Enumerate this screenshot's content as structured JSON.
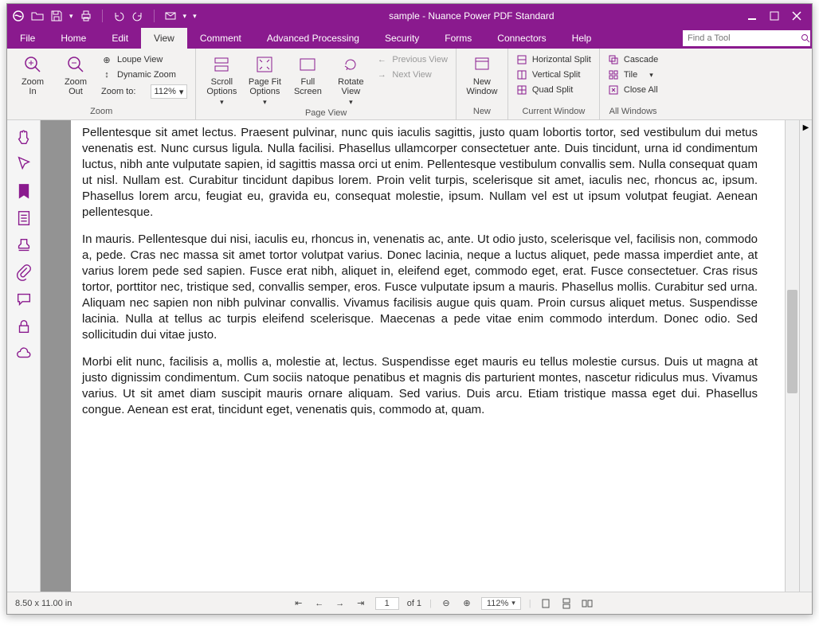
{
  "window": {
    "title": "sample - Nuance Power PDF Standard"
  },
  "menubar": {
    "items": [
      "File",
      "Home",
      "Edit",
      "View",
      "Comment",
      "Advanced Processing",
      "Security",
      "Forms",
      "Connectors",
      "Help"
    ],
    "active_index": 3,
    "search_placeholder": "Find a Tool"
  },
  "ribbon": {
    "zoom": {
      "zoom_in": "Zoom\nIn",
      "zoom_out": "Zoom\nOut",
      "loupe": "Loupe View",
      "dynamic": "Dynamic Zoom",
      "zoom_to": "Zoom to:",
      "zoom_value": "112%",
      "group_label": "Zoom"
    },
    "pageview": {
      "scroll_options": "Scroll\nOptions",
      "page_fit": "Page Fit\nOptions",
      "full_screen": "Full\nScreen",
      "rotate": "Rotate\nView",
      "prev_view": "Previous View",
      "next_view": "Next View",
      "group_label": "Page View"
    },
    "new": {
      "new_window": "New\nWindow",
      "group_label": "New"
    },
    "current": {
      "hsplit": "Horizontal Split",
      "vsplit": "Vertical Split",
      "qsplit": "Quad Split",
      "group_label": "Current Window"
    },
    "allwin": {
      "cascade": "Cascade",
      "tile": "Tile",
      "close_all": "Close All",
      "group_label": "All Windows"
    }
  },
  "document": {
    "paragraphs": [
      "Pellentesque sit amet lectus. Praesent pulvinar, nunc quis iaculis sagittis, justo quam lobortis tortor, sed vestibulum dui metus venenatis est. Nunc cursus ligula. Nulla facilisi. Phasellus ullamcorper consectetuer ante. Duis tincidunt, urna id condimentum luctus, nibh ante vulputate sapien, id sagittis massa orci ut enim. Pellentesque vestibulum convallis sem. Nulla consequat quam ut nisl. Nullam est. Curabitur tincidunt dapibus lorem. Proin velit turpis, scelerisque sit amet, iaculis nec, rhoncus ac, ipsum. Phasellus lorem arcu, feugiat eu, gravida eu, consequat molestie, ipsum. Nullam vel est ut ipsum volutpat feugiat. Aenean pellentesque.",
      "In mauris. Pellentesque dui nisi, iaculis eu, rhoncus in, venenatis ac, ante. Ut odio justo, scelerisque vel, facilisis non, commodo a, pede. Cras nec massa sit amet tortor volutpat varius. Donec lacinia, neque a luctus aliquet, pede massa imperdiet ante, at varius lorem pede sed sapien. Fusce erat nibh, aliquet in, eleifend eget, commodo eget, erat. Fusce consectetuer. Cras risus tortor, porttitor nec, tristique sed, convallis semper, eros. Fusce vulputate ipsum a mauris. Phasellus mollis. Curabitur sed urna. Aliquam nec sapien non nibh pulvinar convallis. Vivamus facilisis augue quis quam. Proin cursus aliquet metus. Suspendisse lacinia. Nulla at tellus ac turpis eleifend scelerisque. Maecenas a pede vitae enim commodo interdum. Donec odio. Sed sollicitudin dui vitae justo.",
      "Morbi elit nunc, facilisis a, mollis a, molestie at, lectus. Suspendisse eget mauris eu tellus molestie cursus. Duis ut magna at justo dignissim condimentum. Cum sociis natoque penatibus et magnis dis parturient montes, nascetur ridiculus mus. Vivamus varius. Ut sit amet diam suscipit mauris ornare aliquam. Sed varius. Duis arcu. Etiam tristique massa eget dui. Phasellus congue. Aenean est erat, tincidunt eget, venenatis quis, commodo at, quam."
    ]
  },
  "statusbar": {
    "page_size": "8.50 x 11.00 in",
    "page_current": "1",
    "page_of": "of 1",
    "zoom": "112%"
  }
}
